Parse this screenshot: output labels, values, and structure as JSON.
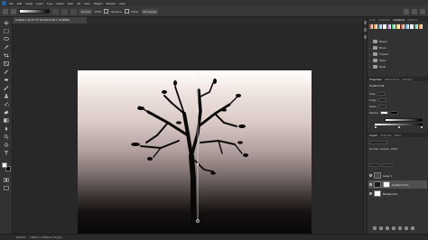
{
  "app": {
    "name": "Photoshop",
    "accent": "#2b5f8f"
  },
  "menu": {
    "items": [
      "File",
      "Edit",
      "Image",
      "Layer",
      "Type",
      "Select",
      "Filter",
      "3D",
      "View",
      "Plugins",
      "Window",
      "Help"
    ]
  },
  "options": {
    "mode_label": "Normal",
    "opacity_label": "100%",
    "reverse_label": "Reverse",
    "dither_label": "Dither",
    "method_label": "Perceptual"
  },
  "document": {
    "tab_title": "Untitled-1 @ 66.7% (Gradient Fill 1, RGB/8#)"
  },
  "status": {
    "zoom": "66.67%",
    "info": "1920 px x 1080 px (72 ppi)"
  },
  "panels": {
    "top_tabs": [
      "Color",
      "Swatches",
      "Gradients",
      "Patterns"
    ],
    "gradient_swatches": [
      "#b01c1c",
      "#e08a2b",
      "#2d7ed0",
      "#ffffff",
      "#8e44ad",
      "#27ae60",
      "#f1c40f",
      "#c0392b",
      "#3498db",
      "#f5f5f5",
      "#16a085",
      "#e67e22"
    ],
    "gradient_groups": [
      "Basics",
      "Blues",
      "Purples",
      "Pinks",
      "Reds"
    ],
    "properties": {
      "tabs": [
        "Properties",
        "Adjustments",
        "Libraries"
      ],
      "title": "Gradient Fill",
      "rows": [
        "Style",
        "Angle",
        "Scale",
        "Method"
      ]
    },
    "layers": {
      "tabs": [
        "Layers",
        "Channels",
        "Paths"
      ],
      "mode": "Normal",
      "opacity": "Opacity: 100%",
      "items": [
        {
          "name": "Layer 1",
          "thumb": "#4a4a4a",
          "selected": false
        },
        {
          "name": "Gradient Fill 1",
          "thumb": "#1a1a1a",
          "selected": true
        },
        {
          "name": "Background",
          "thumb": "#ffffff",
          "selected": false
        }
      ]
    }
  }
}
